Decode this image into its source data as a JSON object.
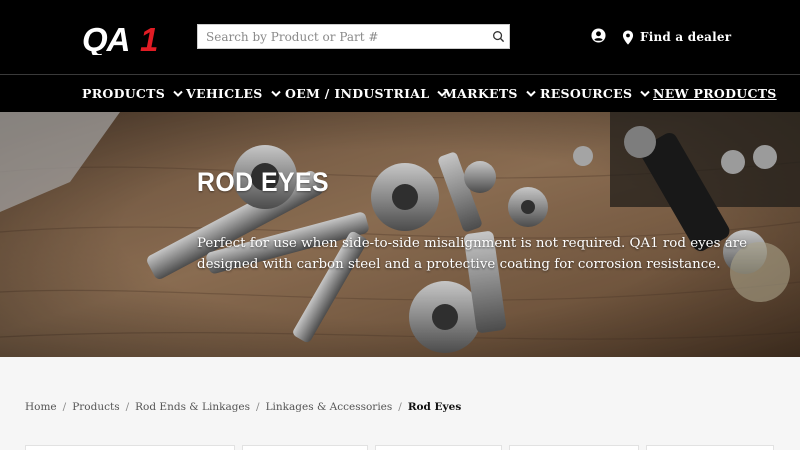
{
  "brand": {
    "logo_text": "QA1",
    "accent": "#e11c24"
  },
  "header": {
    "search": {
      "placeholder": "Search by Product or Part #",
      "value": ""
    },
    "user_icon": "user-circle-icon",
    "dealer_label": "Find a dealer"
  },
  "nav": {
    "items": [
      {
        "label": "PRODUCTS",
        "dropdown": true
      },
      {
        "label": "VEHICLES",
        "dropdown": true
      },
      {
        "label": "OEM / INDUSTRIAL",
        "dropdown": true
      },
      {
        "label": "MARKETS",
        "dropdown": true
      },
      {
        "label": "RESOURCES",
        "dropdown": true
      },
      {
        "label": "NEW PRODUCTS",
        "dropdown": false
      }
    ]
  },
  "hero": {
    "title": "ROD EYES",
    "description": "Perfect for use when side-to-side misalignment is not required. QA1 rod eyes are designed with carbon steel and a protective coating for corrosion resistance."
  },
  "breadcrumb": {
    "items": [
      "Home",
      "Products",
      "Rod Ends & Linkages",
      "Linkages & Accessories"
    ],
    "current": "Rod Eyes"
  }
}
